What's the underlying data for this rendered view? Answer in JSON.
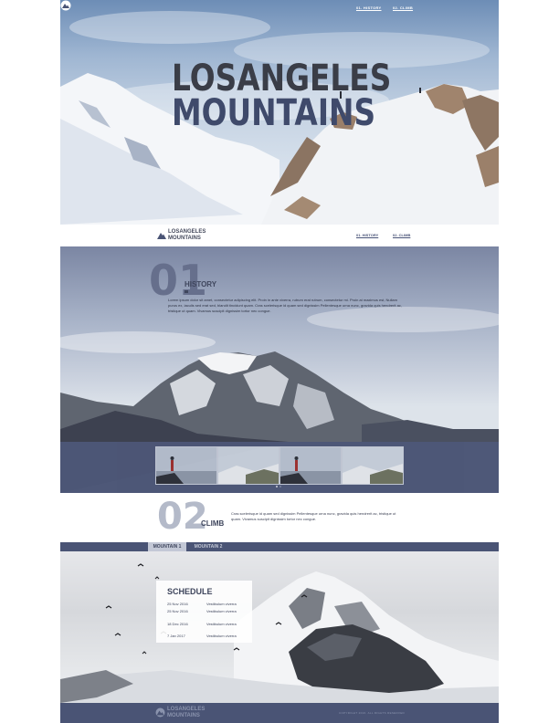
{
  "hero": {
    "nav_history": "01. HISTORY",
    "nav_climb": "02. CLIMB",
    "title_line1": "LOSANGELES",
    "title_line2": "MOUNTAINS"
  },
  "navbar": {
    "logo_line1": "LOSANGELES",
    "logo_line2": "MOUNTAINS",
    "link_history": "01. HISTORY",
    "link_climb": "02. CLIMB"
  },
  "history": {
    "number": "01",
    "title": "HISTORY",
    "text": "Lorem ipsum dolor sit amet, consectetur adipiscing elit. Proin in ante viverra, rutrum erat rutrum, consectetur mi. Proin at maximus est, Nullam purus ex, iaculis sed erat sed, blandit tincidunt quam. Cras scelerisque id quam sed dignissim Pellentesque urna nunc, gravida quis hendrerit ac, tristique ut quam. Vivamus suscipit dignissim tortor nec congue."
  },
  "climb": {
    "number": "02",
    "title": "CLIMB",
    "text": "Cras scelerisque id quam sed dignissim Pellentesque urna nunc, gravida quis hendrerit ac, tristique ut quam. Vivamus suscipit dignissim tortor nec congue."
  },
  "tabs": {
    "tab1": "MOUNTAIN 1",
    "tab2": "MOUNTAIN 2"
  },
  "schedule": {
    "title": "SCHEDULE",
    "rows": [
      {
        "date": "25 Nov 2016",
        "item": "Vestibulum viverra"
      },
      {
        "date": "25 Nov 2016",
        "item": "Vestibulum viverra"
      },
      {
        "date": "18 Dec 2016",
        "item": "Vestibulum viverra"
      },
      {
        "date": "7 Jan 2017",
        "item": "Vestibulum viverra"
      }
    ]
  },
  "footer": {
    "logo_line1": "LOSANGELES",
    "logo_line2": "MOUNTAINS",
    "copyright": "COPYRIGHT 2016. ALL RIGHTS RESERVED"
  },
  "colors": {
    "accent": "#4a5475",
    "dark_text": "#3f465d"
  }
}
